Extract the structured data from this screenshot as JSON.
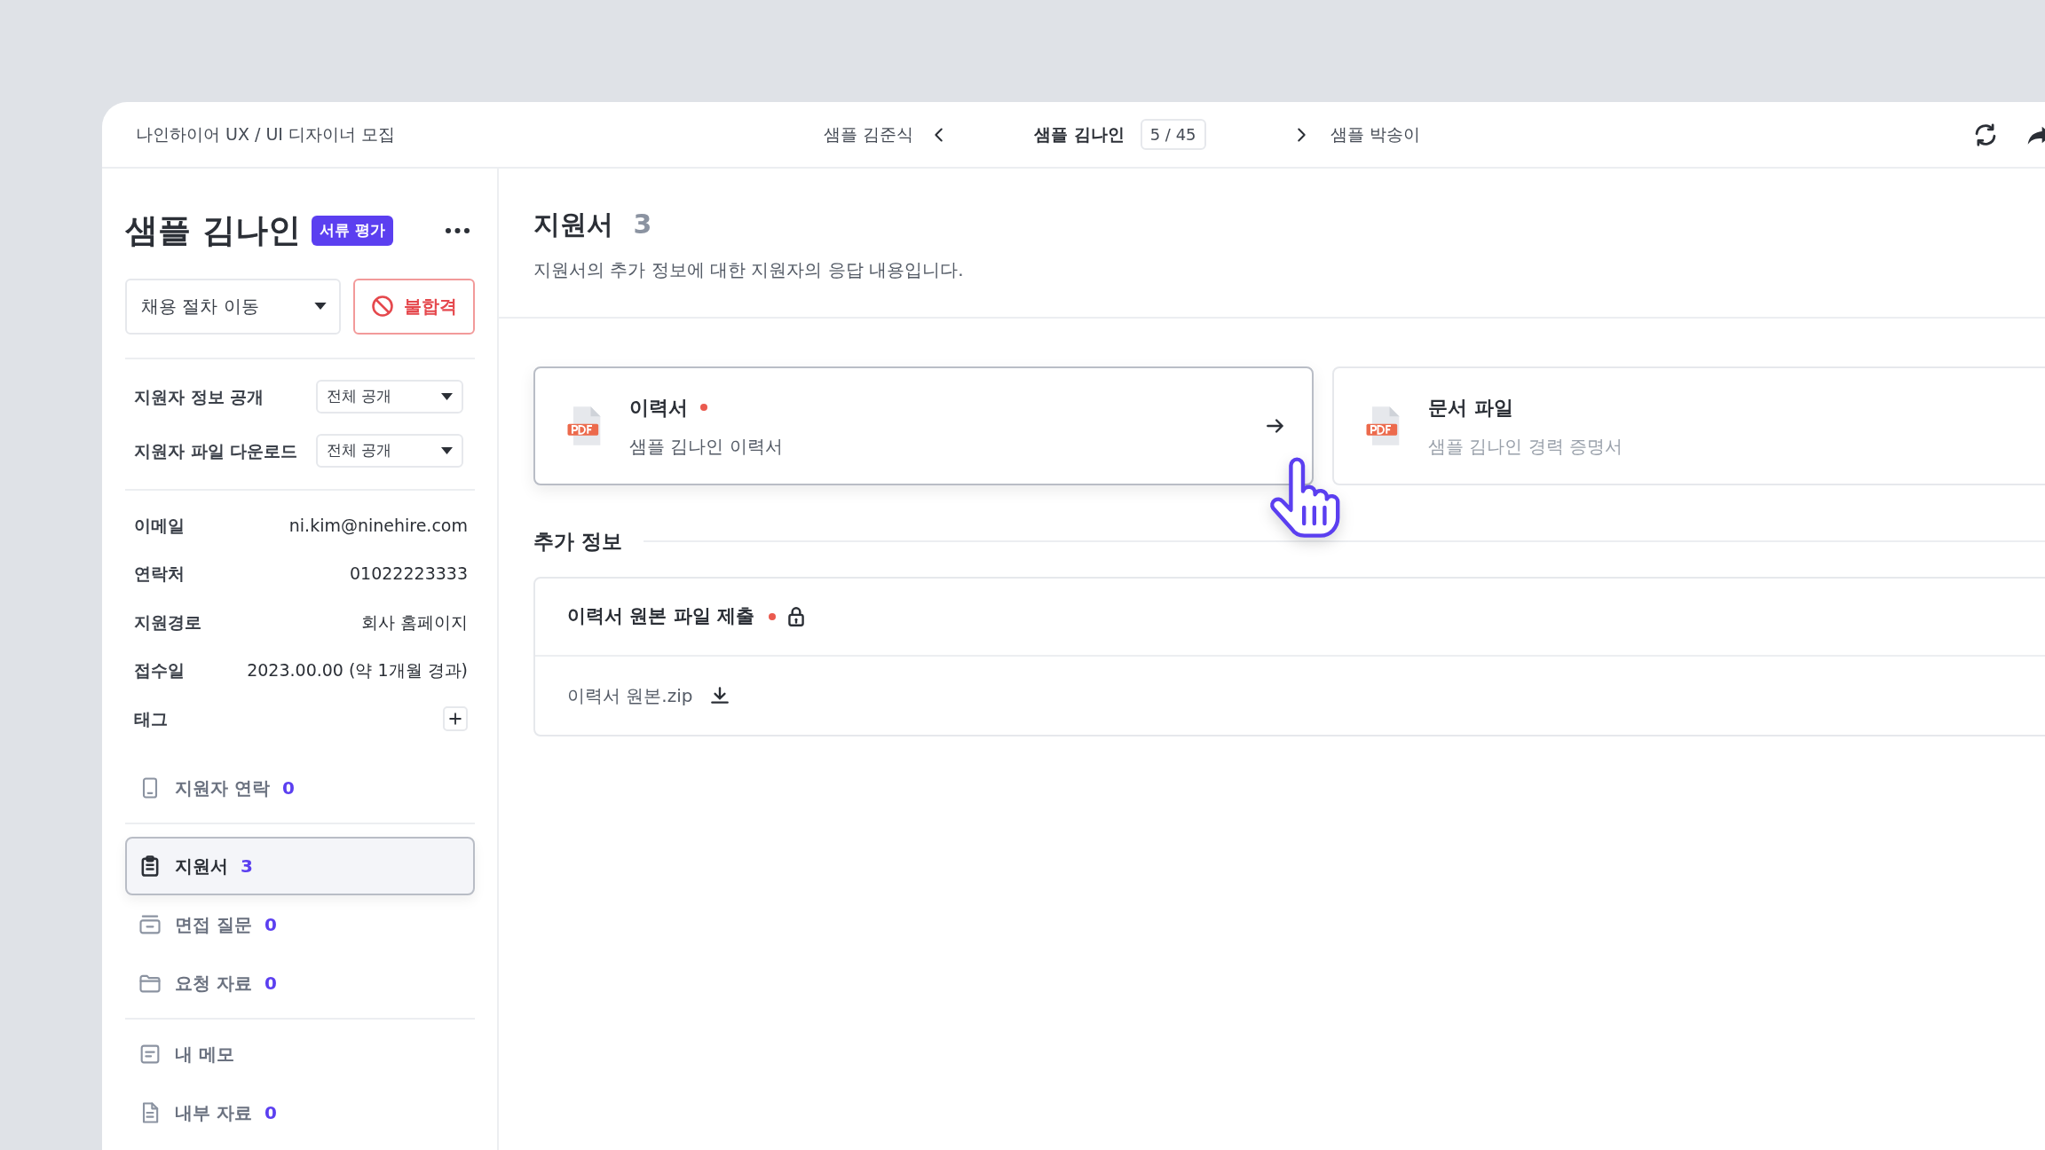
{
  "header": {
    "breadcrumb": "나인하이어 UX / UI 디자이너 모집",
    "prev_applicant": "샘플 김준식",
    "current_applicant": "샘플 김나인",
    "position": "5 / 45",
    "next_applicant": "샘플 박송이"
  },
  "applicant": {
    "name": "샘플 김나인",
    "stage": "서류 평가"
  },
  "actions": {
    "move_stage": "채용 절차 이동",
    "reject": "불합격"
  },
  "settings": [
    {
      "label": "지원자 정보 공개",
      "value": "전체 공개"
    },
    {
      "label": "지원자 파일 다운로드",
      "value": "전체 공개"
    }
  ],
  "info": [
    {
      "kind": "text",
      "label": "이메일",
      "value": "ni.kim@ninehire.com"
    },
    {
      "kind": "text",
      "label": "연락처",
      "value": "01022223333"
    },
    {
      "kind": "text",
      "label": "지원경로",
      "value": "회사 홈페이지"
    },
    {
      "kind": "text",
      "label": "접수일",
      "value": "2023.00.00 (약 1개월 경과)"
    },
    {
      "kind": "add",
      "label": "태그"
    }
  ],
  "nav_groups": [
    {
      "items": [
        {
          "label": "지원자 연락",
          "count": "0",
          "selected": false
        }
      ]
    },
    {
      "items": [
        {
          "label": "지원서",
          "count": "3",
          "selected": true
        },
        {
          "label": "면접 질문",
          "count": "0",
          "selected": false
        },
        {
          "label": "요청 자료",
          "count": "0",
          "selected": false
        }
      ]
    },
    {
      "items": [
        {
          "label": "내 메모",
          "selected": false
        },
        {
          "label": "내부 자료",
          "count": "0",
          "selected": false
        }
      ]
    }
  ],
  "main": {
    "title": "지원서",
    "count": "3",
    "description": "지원서의 추가 정보에 대한 지원자의 응답 내용입니다."
  },
  "documents": [
    {
      "title": "이력서",
      "required": true,
      "subtitle": "샘플 김나인 이력서",
      "hovered": true
    },
    {
      "title": "문서 파일",
      "required": false,
      "subtitle": "샘플 김나인 경력 증명서",
      "hovered": false
    }
  ],
  "extra_info": {
    "title": "추가 정보",
    "questions": [
      {
        "title": "이력서 원본 파일 제출",
        "required": true,
        "locked": true,
        "file": "이력서 원본.zip"
      }
    ]
  }
}
